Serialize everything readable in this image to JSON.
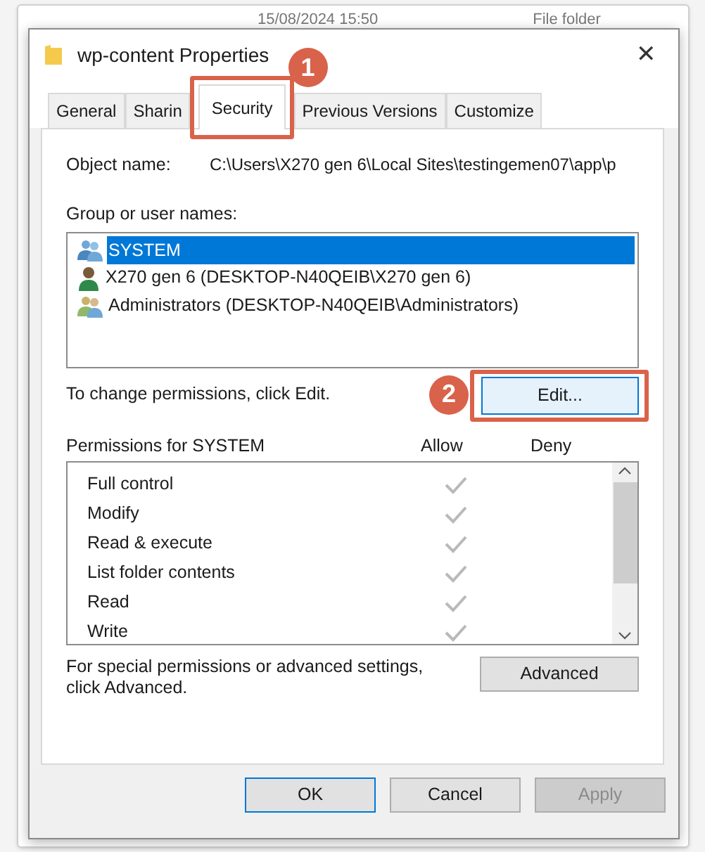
{
  "background_window": {
    "date_modified": "15/08/2024 15:50",
    "type": "File folder"
  },
  "window": {
    "title": "wp-content Properties",
    "close": "✕"
  },
  "tabs": [
    {
      "label": "General",
      "selected": false
    },
    {
      "label": "Sharin",
      "selected": false
    },
    {
      "label": "Security",
      "selected": true
    },
    {
      "label": "Previous Versions",
      "selected": false
    },
    {
      "label": "Customize",
      "selected": false
    }
  ],
  "object_name": {
    "label": "Object name:",
    "value": "C:\\Users\\X270 gen 6\\Local Sites\\testingemen07\\app\\p"
  },
  "users": {
    "label": "Group or user names:",
    "items": [
      {
        "name": "SYSTEM",
        "kind": "group",
        "selected": true
      },
      {
        "name": "X270 gen 6 (DESKTOP-N40QEIB\\X270 gen 6)",
        "kind": "user",
        "selected": false
      },
      {
        "name": "Administrators (DESKTOP-N40QEIB\\Administrators)",
        "kind": "admins",
        "selected": false
      }
    ]
  },
  "change_hint": "To change permissions, click Edit.",
  "edit_button": "Edit...",
  "permissions": {
    "label": "Permissions for SYSTEM",
    "allow_header": "Allow",
    "deny_header": "Deny",
    "rows": [
      {
        "name": "Full control",
        "allow": true,
        "deny": false
      },
      {
        "name": "Modify",
        "allow": true,
        "deny": false
      },
      {
        "name": "Read & execute",
        "allow": true,
        "deny": false
      },
      {
        "name": "List folder contents",
        "allow": true,
        "deny": false
      },
      {
        "name": "Read",
        "allow": true,
        "deny": false
      },
      {
        "name": "Write",
        "allow": true,
        "deny": false
      }
    ]
  },
  "advanced_hint": "For special permissions or advanced settings, click Advanced.",
  "advanced_button": "Advanced",
  "buttons": [
    {
      "label": "OK",
      "kind": "default",
      "disabled": false
    },
    {
      "label": "Cancel",
      "kind": "normal",
      "disabled": false
    },
    {
      "label": "Apply",
      "kind": "normal",
      "disabled": true
    }
  ],
  "annotations": [
    {
      "number": "1"
    },
    {
      "number": "2"
    }
  ]
}
